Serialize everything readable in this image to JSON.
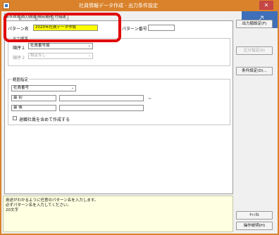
{
  "window": {
    "title": "社員情報データ作成 - 出力条件設定",
    "close_glyph": "✕",
    "badge_glyph": "⤢"
  },
  "tabs": [
    {
      "label": "基本設定",
      "active": true
    },
    {
      "label": "出力設定",
      "active": false
    },
    {
      "label": "項目選択",
      "active": false
    },
    {
      "label": "行指定",
      "active": false
    }
  ],
  "pattern": {
    "name_label": "パターン名",
    "name_value": "2020年社員データ作成",
    "number_label": "パターン番号",
    "number_value": ""
  },
  "sort": {
    "group_title": "出力順序",
    "sort1_label": "順序１",
    "sort1_value": "社員番号順",
    "sort2_label": "順序２",
    "sort2_value": "設定なし"
  },
  "range": {
    "group_title": "範囲指定",
    "field_value": "社員番号",
    "start_label": "最 初",
    "start_value": "",
    "start_name": "",
    "end_label": "最 後",
    "end_value": "",
    "end_name": "",
    "tilde": "~",
    "retired_checkbox_label": "退職社員を含めて作成する",
    "retired_checked": false
  },
  "side_buttons": {
    "output_sort": "出力順設定(F)",
    "subtotal": "区分指定(A)",
    "condition": "条件設定(D)...",
    "cancel": "ｷｬﾝｾﾙ",
    "help": "操作説明(H)"
  },
  "help_text": {
    "line1": "用途がわかるように任意のパターン名を入力します。",
    "line2": "必ずパターン名を入力してください。",
    "line3": "20文字"
  }
}
